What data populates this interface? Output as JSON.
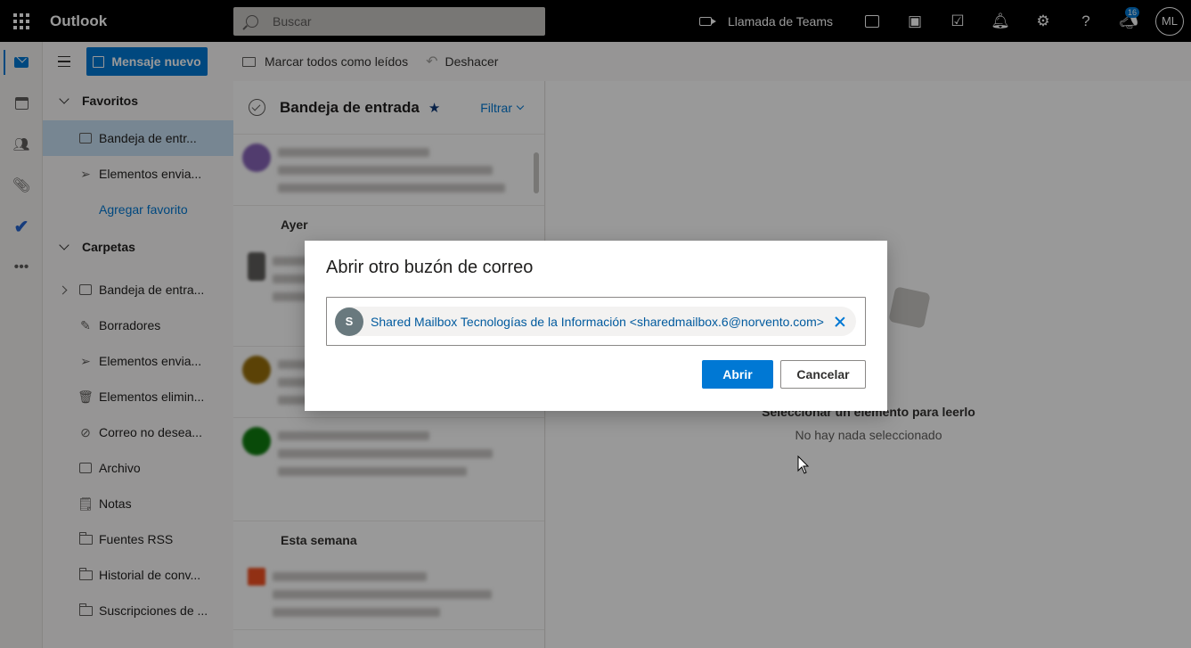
{
  "topbar": {
    "app_name": "Outlook",
    "search_placeholder": "Buscar",
    "teams_call": "Llamada de Teams",
    "notifications_count": "16",
    "user_initials": "ML"
  },
  "toolbar": {
    "new_message": "Mensaje nuevo",
    "mark_all_read": "Marcar todos como leídos",
    "undo": "Deshacer"
  },
  "folders": {
    "favorites_header": "Favoritos",
    "favorites": [
      {
        "label": "Bandeja de entr...",
        "icon": "inbox-icon"
      },
      {
        "label": "Elementos envia...",
        "icon": "send-icon"
      }
    ],
    "add_favorite": "Agregar favorito",
    "folders_header": "Carpetas",
    "items": [
      {
        "label": "Bandeja de entra...",
        "icon": "inbox-icon"
      },
      {
        "label": "Borradores",
        "icon": "pencil-icon"
      },
      {
        "label": "Elementos envia...",
        "icon": "send-icon"
      },
      {
        "label": "Elementos elimin...",
        "icon": "trash-icon"
      },
      {
        "label": "Correo no desea...",
        "icon": "block-icon"
      },
      {
        "label": "Archivo",
        "icon": "archive-icon"
      },
      {
        "label": "Notas",
        "icon": "note-icon"
      },
      {
        "label": "Fuentes RSS",
        "icon": "folder-icon"
      },
      {
        "label": "Historial de conv...",
        "icon": "folder-icon"
      },
      {
        "label": "Suscripciones de ...",
        "icon": "folder-icon"
      }
    ]
  },
  "message_list": {
    "title": "Bandeja de entrada",
    "filter": "Filtrar",
    "group_yesterday": "Ayer",
    "group_this_week": "Esta semana"
  },
  "reading_pane": {
    "select_prompt": "Seleccionar un elemento para leerlo",
    "nothing_selected": "No hay nada seleccionado"
  },
  "dialog": {
    "title": "Abrir otro buzón de correo",
    "persona_initial": "S",
    "persona_text": "Shared Mailbox Tecnologías de la Información <sharedmailbox.6@norvento.com>",
    "open_button": "Abrir",
    "cancel_button": "Cancelar"
  },
  "colors": {
    "accent": "#0078d4",
    "topbar": "#000000",
    "persona_avatar": "#69797e"
  }
}
